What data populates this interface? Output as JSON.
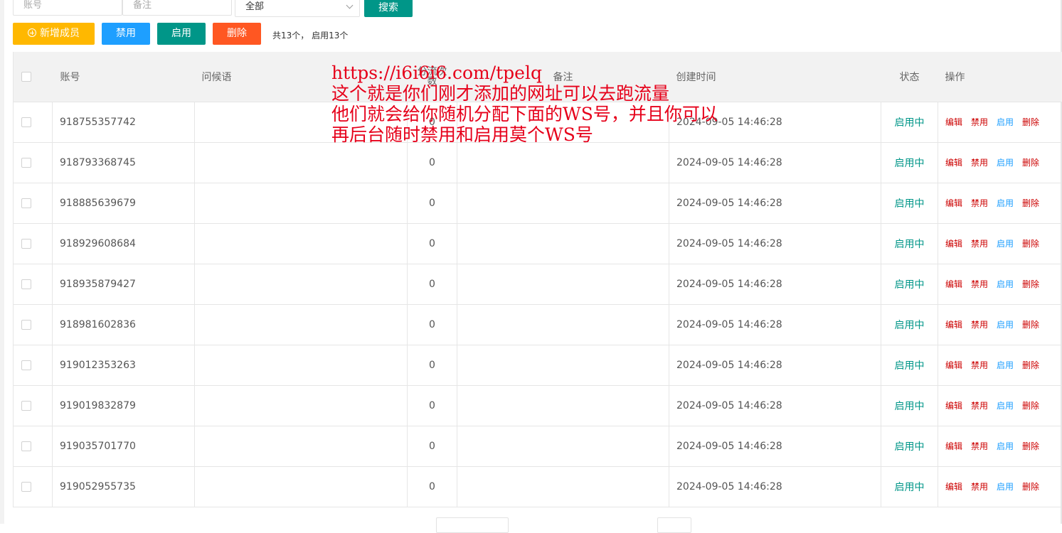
{
  "search": {
    "account_placeholder": "账号",
    "remark_placeholder": "备注",
    "status_select_value": "全部",
    "search_button": "搜索"
  },
  "toolbar": {
    "add_label": "新增成员",
    "disable_label": "禁用",
    "enable_label": "启用",
    "delete_label": "删除",
    "summary": "共13个， 启用13个"
  },
  "table": {
    "headers": {
      "account": "账号",
      "greeting": "问候语",
      "count": "分流次数",
      "remark": "备注",
      "created": "创建时间",
      "status": "状态",
      "actions": "操作"
    },
    "actions": [
      "编辑",
      "禁用",
      "启用",
      "删除"
    ],
    "rows": [
      {
        "account": "918755357742",
        "greeting": "",
        "count": "0",
        "remark": "",
        "created": "2024-09-05 14:46:28",
        "status": "启用中"
      },
      {
        "account": "918793368745",
        "greeting": "",
        "count": "0",
        "remark": "",
        "created": "2024-09-05 14:46:28",
        "status": "启用中"
      },
      {
        "account": "918885639679",
        "greeting": "",
        "count": "0",
        "remark": "",
        "created": "2024-09-05 14:46:28",
        "status": "启用中"
      },
      {
        "account": "918929608684",
        "greeting": "",
        "count": "0",
        "remark": "",
        "created": "2024-09-05 14:46:28",
        "status": "启用中"
      },
      {
        "account": "918935879427",
        "greeting": "",
        "count": "0",
        "remark": "",
        "created": "2024-09-05 14:46:28",
        "status": "启用中"
      },
      {
        "account": "918981602836",
        "greeting": "",
        "count": "0",
        "remark": "",
        "created": "2024-09-05 14:46:28",
        "status": "启用中"
      },
      {
        "account": "919012353263",
        "greeting": "",
        "count": "0",
        "remark": "",
        "created": "2024-09-05 14:46:28",
        "status": "启用中"
      },
      {
        "account": "919019832879",
        "greeting": "",
        "count": "0",
        "remark": "",
        "created": "2024-09-05 14:46:28",
        "status": "启用中"
      },
      {
        "account": "919035701770",
        "greeting": "",
        "count": "0",
        "remark": "",
        "created": "2024-09-05 14:46:28",
        "status": "启用中"
      },
      {
        "account": "919052955735",
        "greeting": "",
        "count": "0",
        "remark": "",
        "created": "2024-09-05 14:46:28",
        "status": "启用中"
      }
    ]
  },
  "annotation": {
    "lines": [
      "https://i6i6i6.com/tpelq",
      "这个就是你们刚才添加的网址可以去跑流量",
      "他们就会给你随机分配下面的WS号，并且你可以",
      "再后台随时禁用和启用莫个WS号"
    ],
    "color": "#e6001a"
  },
  "colors": {
    "primary_green": "#009688",
    "blue": "#1e9fff",
    "orange": "#ffb800",
    "red": "#ff5722"
  }
}
